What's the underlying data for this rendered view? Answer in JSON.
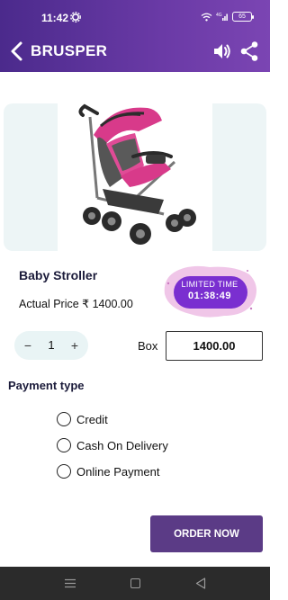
{
  "status_bar": {
    "time": "11:42",
    "battery": "65",
    "network": "4G"
  },
  "app_bar": {
    "title": "BRUSPER",
    "back_icon": "chevron-left-icon",
    "speaker_icon": "speaker-icon",
    "share_icon": "share-icon"
  },
  "product": {
    "name": "Baby Stroller",
    "actual_price": "Actual Price ₹ 1400.00",
    "image": "stroller-image"
  },
  "offer": {
    "label": "LIMITED TIME",
    "timer": "01:38:49"
  },
  "quantity": {
    "minus": "−",
    "value": "1",
    "plus": "+"
  },
  "box": {
    "label": "Box",
    "value": "1400.00"
  },
  "payment": {
    "title": "Payment type",
    "options": [
      "Credit",
      "Cash On Delivery",
      "Online Payment"
    ]
  },
  "order_button": "ORDER NOW",
  "colors": {
    "brand": "#5b3b86",
    "header_start": "#4b2a8c",
    "header_end": "#7b45b3",
    "stepper_bg": "#e9f4f5",
    "timer_bg": "#7a2fd0"
  }
}
